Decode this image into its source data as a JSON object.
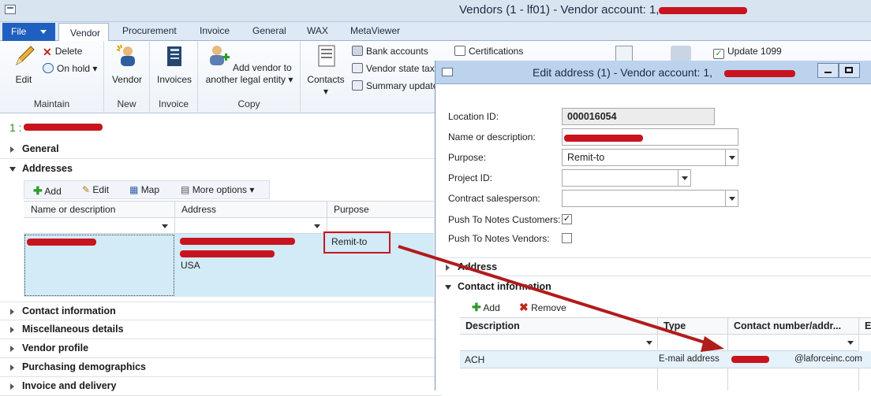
{
  "window": {
    "title": "Vendors (1 - lf01) - Vendor account: 1,"
  },
  "tabs": {
    "file": "File",
    "items": [
      "Vendor",
      "Procurement",
      "Invoice",
      "General",
      "WAX",
      "MetaViewer"
    ]
  },
  "ribbon": {
    "edit": "Edit",
    "delete": "Delete",
    "on_hold": "On hold",
    "maintain": "Maintain",
    "vendor": "Vendor",
    "new": "New",
    "invoices": "Invoices",
    "invoice": "Invoice",
    "add_vendor_1": "Add vendor to",
    "add_vendor_2": "another legal entity",
    "copy": "Copy",
    "contacts": "Contacts",
    "bank_accounts": "Bank accounts",
    "vendor_state_tax": "Vendor state tax",
    "summary_update": "Summary update",
    "certifications": "Certifications",
    "update_1099": "Update 1099"
  },
  "record": {
    "prefix": "1 :"
  },
  "fasttabs": {
    "general": "General",
    "addresses": "Addresses",
    "contact_information": "Contact information",
    "misc": "Miscellaneous details",
    "vendor_profile": "Vendor profile",
    "purchasing": "Purchasing demographics",
    "invoice_delivery": "Invoice and delivery"
  },
  "addresses": {
    "toolbar": {
      "add": "Add",
      "edit": "Edit",
      "map": "Map",
      "more": "More options"
    },
    "columns": [
      "Name or description",
      "Address",
      "Purpose"
    ],
    "row": {
      "address_country": "USA",
      "purpose": "Remit-to"
    }
  },
  "dialog": {
    "title": "Edit address (1) - Vendor account: 1,",
    "labels": {
      "location_id": "Location ID:",
      "name": "Name or description:",
      "purpose": "Purpose:",
      "project_id": "Project ID:",
      "contract_salesperson": "Contract salesperson:",
      "push_customers": "Push To Notes Customers:",
      "push_vendors": "Push To Notes Vendors:"
    },
    "values": {
      "location_id": "000016054",
      "purpose": "Remit-to",
      "push_customers": "✓"
    },
    "address_tab": "Address",
    "contact_tab": "Contact information",
    "contact_toolbar": {
      "add": "Add",
      "remove": "Remove"
    },
    "contact_columns": [
      "Description",
      "Type",
      "Contact number/addr...",
      "E"
    ],
    "contact_row": {
      "description": "ACH",
      "type": "E-mail address",
      "contact": "@laforceinc.com"
    }
  },
  "colors": {
    "accent": "#1f5fbf",
    "redaction": "#c8141e",
    "annotation_arrow": "#b11c1c"
  }
}
